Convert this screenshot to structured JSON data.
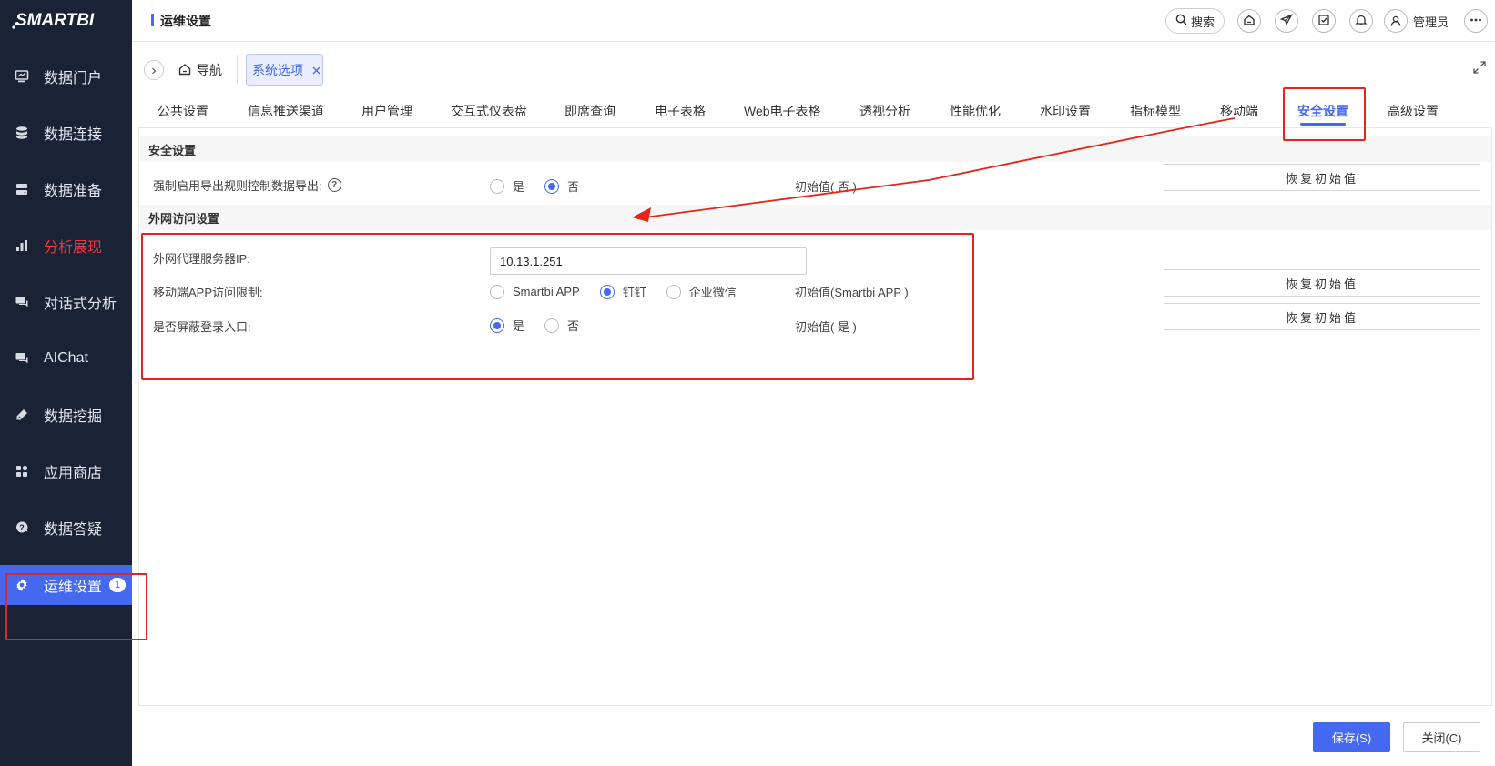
{
  "app": {
    "logo_text": "SMARTBI"
  },
  "sidebar": {
    "items": [
      {
        "label": "数据门户",
        "icon": "monitor-icon"
      },
      {
        "label": "数据连接",
        "icon": "database-icon"
      },
      {
        "label": "数据准备",
        "icon": "server-icon"
      },
      {
        "label": "分析展现",
        "icon": "bar-chart-icon"
      },
      {
        "label": "对话式分析",
        "icon": "chat-icon"
      },
      {
        "label": "AIChat",
        "icon": "chat-icon"
      },
      {
        "label": "数据挖掘",
        "icon": "pickaxe-icon"
      },
      {
        "label": "应用商店",
        "icon": "apps-icon"
      },
      {
        "label": "数据答疑",
        "icon": "question-icon"
      },
      {
        "label": "运维设置",
        "icon": "gear-icon",
        "badge": "1"
      }
    ]
  },
  "header": {
    "title": "运维设置",
    "search_label": "搜索",
    "user_name": "管理员"
  },
  "tabs": {
    "nav_label": "导航",
    "open_tab_label": "系统选项"
  },
  "settings_tabs": [
    "公共设置",
    "信息推送渠道",
    "用户管理",
    "交互式仪表盘",
    "即席查询",
    "电子表格",
    "Web电子表格",
    "透视分析",
    "性能优化",
    "水印设置",
    "指标模型",
    "移动端",
    "安全设置",
    "高级设置"
  ],
  "security": {
    "section_title": "安全设置",
    "export_rule_label": "强制启用导出规则控制数据导出:",
    "export_rule_options": [
      "是",
      "否"
    ],
    "export_rule_selected": "否",
    "export_rule_initial": "初始值( 否 )",
    "reset_label": "恢复初始值"
  },
  "external": {
    "section_title": "外网访问设置",
    "proxy_ip_label": "外网代理服务器IP:",
    "proxy_ip_value": "10.13.1.251",
    "mobile_limit_label": "移动端APP访问限制:",
    "mobile_options": [
      "Smartbi APP",
      "钉钉",
      "企业微信"
    ],
    "mobile_selected": "钉钉",
    "mobile_initial": "初始值(Smartbi APP )",
    "hide_login_label": "是否屏蔽登录入口:",
    "hide_login_options": [
      "是",
      "否"
    ],
    "hide_login_selected": "是",
    "hide_login_initial": "初始值( 是 )",
    "reset_label": "恢复初始值"
  },
  "footer": {
    "save_label": "保存(S)",
    "close_label": "关闭(C)"
  },
  "colors": {
    "accent": "#4468f0",
    "sidebar_bg": "#1a2236",
    "annotation": "#e8231a",
    "alert_text": "#f5333f"
  }
}
